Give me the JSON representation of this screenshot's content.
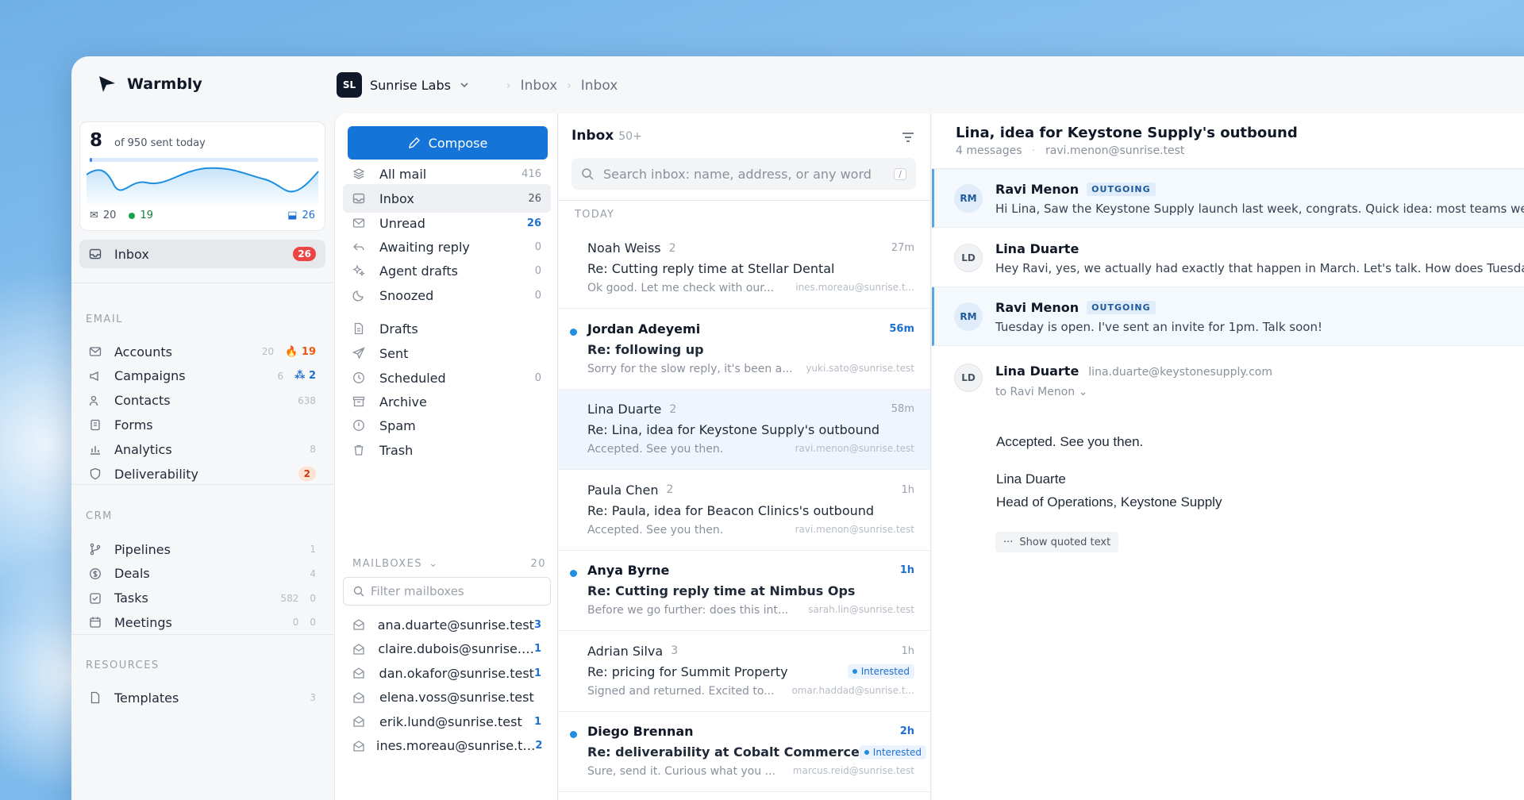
{
  "brand": {
    "name": "Warmbly"
  },
  "org": {
    "initials": "SL",
    "name": "Sunrise Labs"
  },
  "breadcrumb": [
    "Inbox",
    "Inbox"
  ],
  "send_stat": {
    "count": "8",
    "label": "of 950 sent today",
    "progress": 0.0084,
    "sent": "20",
    "active": "19",
    "inbox": "26"
  },
  "sidebar": {
    "inbox": {
      "label": "Inbox",
      "badge": "26"
    },
    "email_title": "EMAIL",
    "email": [
      {
        "label": "Accounts",
        "count": "20",
        "extra": "19",
        "icon": "envelope-icon"
      },
      {
        "label": "Campaigns",
        "count": "6",
        "extra": "2",
        "icon": "megaphone-icon"
      },
      {
        "label": "Contacts",
        "count": "638",
        "icon": "users-icon"
      },
      {
        "label": "Forms",
        "count": "",
        "icon": "clipboard-icon"
      },
      {
        "label": "Analytics",
        "count": "8",
        "icon": "chart-icon"
      },
      {
        "label": "Deliverability",
        "badge": "2",
        "icon": "shield-icon"
      }
    ],
    "crm_title": "CRM",
    "crm": [
      {
        "label": "Pipelines",
        "count": "1",
        "icon": "branch-icon"
      },
      {
        "label": "Deals",
        "count": "4",
        "icon": "dollar-icon"
      },
      {
        "label": "Tasks",
        "count": "582",
        "count2": "0",
        "icon": "checkbox-icon"
      },
      {
        "label": "Meetings",
        "count": "0",
        "count2": "0",
        "icon": "calendar-icon"
      }
    ],
    "resources_title": "RESOURCES",
    "resources": [
      {
        "label": "Templates",
        "count": "3",
        "icon": "document-icon"
      }
    ]
  },
  "folders": {
    "compose": "Compose",
    "items": [
      {
        "label": "All mail",
        "count": "416",
        "icon": "layers-icon"
      },
      {
        "label": "Inbox",
        "count": "26",
        "icon": "inbox-icon"
      },
      {
        "label": "Unread",
        "count": "26",
        "icon": "envelope-icon"
      },
      {
        "label": "Awaiting reply",
        "count": "0",
        "icon": "reply-icon"
      },
      {
        "label": "Agent drafts",
        "count": "0",
        "icon": "sparkles-icon"
      },
      {
        "label": "Snoozed",
        "count": "0",
        "icon": "moon-icon"
      },
      {
        "label": "Drafts",
        "count": "",
        "icon": "file-icon"
      },
      {
        "label": "Sent",
        "count": "",
        "icon": "send-icon"
      },
      {
        "label": "Scheduled",
        "count": "0",
        "icon": "clock-icon"
      },
      {
        "label": "Archive",
        "count": "",
        "icon": "archive-icon"
      },
      {
        "label": "Spam",
        "count": "",
        "icon": "alert-icon"
      },
      {
        "label": "Trash",
        "count": "",
        "icon": "trash-icon"
      }
    ],
    "mailboxes_title": "MAILBOXES",
    "mailboxes_count": "20",
    "filter_placeholder": "Filter mailboxes",
    "mailboxes": [
      {
        "address": "ana.duarte@sunrise.test",
        "count": "3"
      },
      {
        "address": "claire.dubois@sunrise.…",
        "count": "1"
      },
      {
        "address": "dan.okafor@sunrise.test",
        "count": "1"
      },
      {
        "address": "elena.voss@sunrise.test",
        "count": ""
      },
      {
        "address": "erik.lund@sunrise.test",
        "count": "1"
      },
      {
        "address": "ines.moreau@sunrise.t…",
        "count": "2"
      }
    ]
  },
  "list": {
    "title": "Inbox",
    "count": "50+",
    "search_placeholder": "Search inbox: name, address, or any word",
    "kbd": "/",
    "group": "TODAY",
    "messages": [
      {
        "from": "Noah Weiss",
        "n": "2",
        "time": "27m",
        "subject": "Re: Cutting reply time at Stellar Dental",
        "preview": "Ok good. Let me check with our...",
        "address": "ines.moreau@sunrise.t...",
        "unread": false
      },
      {
        "from": "Jordan Adeyemi",
        "n": "",
        "time": "56m",
        "subject": "Re: following up",
        "preview": "Sorry for the slow reply, it's been a...",
        "address": "yuki.sato@sunrise.test",
        "unread": true
      },
      {
        "from": "Lina Duarte",
        "n": "2",
        "time": "58m",
        "subject": "Re: Lina, idea for Keystone Supply's outbound",
        "preview": "Accepted. See you then.",
        "address": "ravi.menon@sunrise.test",
        "unread": false,
        "selected": true
      },
      {
        "from": "Paula Chen",
        "n": "2",
        "time": "1h",
        "subject": "Re: Paula, idea for Beacon Clinics's outbound",
        "preview": "Accepted. See you then.",
        "address": "ravi.menon@sunrise.test",
        "unread": false
      },
      {
        "from": "Anya Byrne",
        "n": "",
        "time": "1h",
        "subject": "Re: Cutting reply time at Nimbus Ops",
        "preview": "Before we go further: does this int...",
        "address": "sarah.lin@sunrise.test",
        "unread": true
      },
      {
        "from": "Adrian Silva",
        "n": "3",
        "time": "1h",
        "subject": "Re: pricing for Summit Property",
        "tag": "Interested",
        "preview": "Signed and returned. Excited to...",
        "address": "omar.haddad@sunrise.t...",
        "unread": false
      },
      {
        "from": "Diego Brennan",
        "n": "",
        "time": "2h",
        "subject": "Re: deliverability at Cobalt Commerce",
        "tag": "Interested",
        "preview": "Sure, send it. Curious what you ...",
        "address": "marcus.reid@sunrise.test",
        "unread": true
      }
    ]
  },
  "thread": {
    "title": "Lina, idea for Keystone Supply's outbound",
    "count": "4 messages",
    "address": "ravi.menon@sunrise.test",
    "messages": [
      {
        "initials": "RM",
        "from": "Ravi Menon",
        "badge": "OUTGOING",
        "preview": "Hi Lina, Saw the Keystone Supply launch last week, congrats. Quick idea: most teams we talk to"
      },
      {
        "initials": "LD",
        "from": "Lina Duarte",
        "badge": "",
        "preview": "Hey Ravi, yes, we actually had exactly that happen in March. Let's talk. How does Tuesday look?"
      },
      {
        "initials": "RM",
        "from": "Ravi Menon",
        "badge": "OUTGOING",
        "preview": "Tuesday is open. I've sent an invite for 1pm. Talk soon!"
      }
    ],
    "open": {
      "initials": "LD",
      "from": "Lina Duarte",
      "email": "lina.duarte@keystonesupply.com",
      "to": "to Ravi Menon",
      "body": [
        "Accepted. See you then.",
        "Lina Duarte",
        "Head of Operations, Keystone Supply"
      ],
      "quoted": "Show quoted text"
    }
  },
  "colors": {
    "accent": "#1574d8",
    "unread_dot": "#1d8fe0",
    "badge_red": "#ef4444"
  }
}
